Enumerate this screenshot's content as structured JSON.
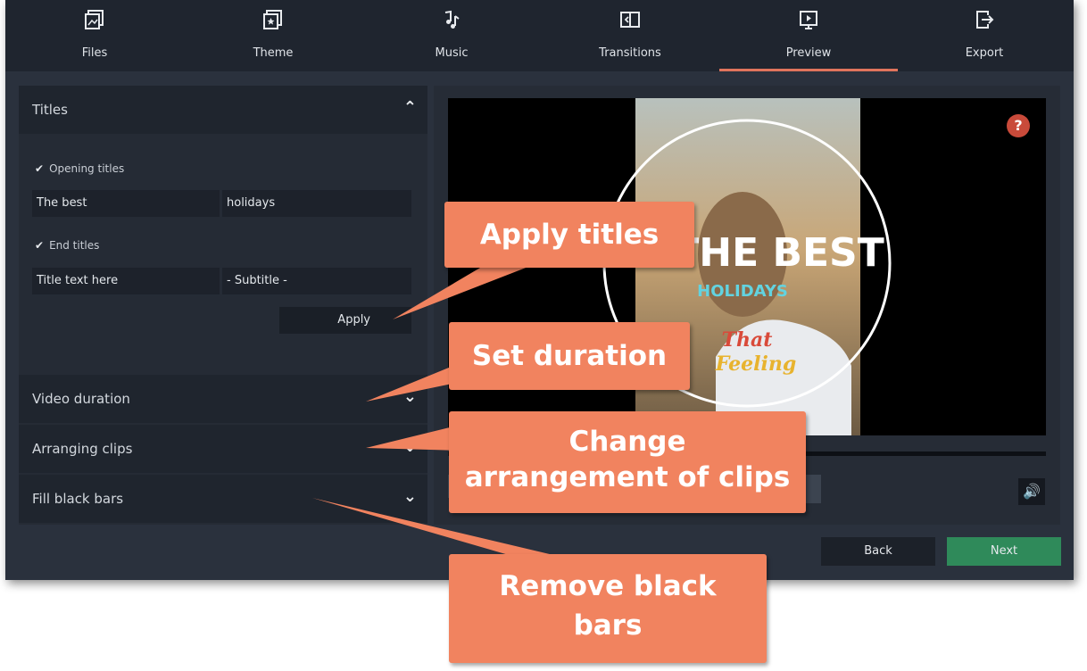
{
  "tabs": [
    {
      "label": "Files",
      "icon": "files-icon"
    },
    {
      "label": "Theme",
      "icon": "theme-icon"
    },
    {
      "label": "Music",
      "icon": "music-icon"
    },
    {
      "label": "Transitions",
      "icon": "transitions-icon"
    },
    {
      "label": "Preview",
      "icon": "preview-icon",
      "active": true
    },
    {
      "label": "Export",
      "icon": "export-icon"
    }
  ],
  "titles_section": {
    "header": "Titles",
    "opening_label": "Opening titles",
    "opening_title": "The best",
    "opening_subtitle": "holidays",
    "end_label": "End titles",
    "end_title": "Title text here",
    "end_subtitle": "- Subtitle -",
    "apply_label": "Apply"
  },
  "sections": {
    "video_duration": "Video duration",
    "arranging_clips": "Arranging clips",
    "fill_black_bars": "Fill black bars"
  },
  "preview": {
    "title_text": "THE BEST",
    "subtitle_text": "HOLIDAYS",
    "shirt_text_1": "That",
    "shirt_text_2": "Feeling",
    "help": "?"
  },
  "footer": {
    "back_label": "Back",
    "next_label": "Next"
  },
  "callouts": {
    "apply_titles": "Apply titles",
    "set_duration": "Set duration",
    "change_arrangement_1": "Change",
    "change_arrangement_2": "arrangement of clips",
    "remove_bars_1": "Remove black",
    "remove_bars_2": "bars"
  },
  "colors": {
    "accent": "#e0745c",
    "callout": "#f1835f",
    "next_button": "#2f8a5a",
    "help_badge": "#c94a3a"
  }
}
